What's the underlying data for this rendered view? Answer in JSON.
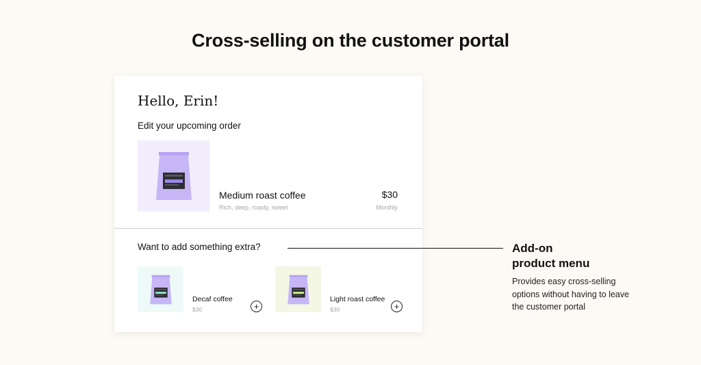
{
  "headline": "Cross-selling on the customer portal",
  "portal": {
    "greeting": "Hello, Erin!",
    "edit_label": "Edit your upcoming order",
    "main_product": {
      "name": "Medium roast coffee",
      "description": "Rich, deep, roasty, sweet",
      "price": "$30",
      "frequency": "Monthly",
      "tile_color": "#f1edfc",
      "label_color": "#9a87e6"
    },
    "extra_label": "Want to add something extra?",
    "addons": [
      {
        "name": "Decaf coffee",
        "price": "$30",
        "tile_color": "#eefaf7",
        "label_color": "#8fe0cc",
        "icon": "plus-circle-icon"
      },
      {
        "name": "Light roast coffee",
        "price": "$30",
        "tile_color": "#f3f7e4",
        "label_color": "#c9ec7c",
        "icon": "plus-circle-icon"
      }
    ]
  },
  "callout": {
    "title_line1": "Add-on",
    "title_line2": "product menu",
    "description": "Provides easy cross-selling options without having to leave the customer portal"
  },
  "colors": {
    "page_bg": "#fdf9f4",
    "bag": "#c6b6f6",
    "bag_label": "#2d2d33"
  }
}
